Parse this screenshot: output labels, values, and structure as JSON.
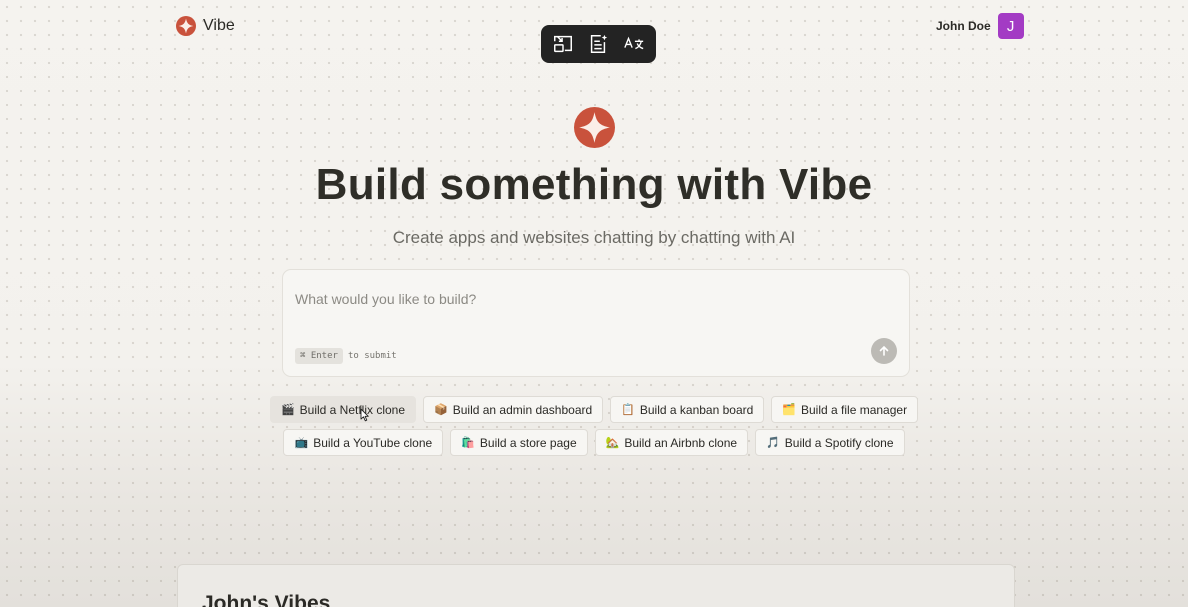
{
  "header": {
    "brand": "Vibe",
    "user_name": "John Doe",
    "avatar_initial": "J"
  },
  "toolbar": {
    "icons": [
      "exit-pip-icon",
      "ai-document-icon",
      "translate-icon"
    ]
  },
  "hero": {
    "title": "Build something with Vibe",
    "subtitle": "Create apps and websites chatting by chatting with AI"
  },
  "prompt": {
    "placeholder": "What would you like to build?",
    "value": "",
    "shortcut_key": "⌘ Enter",
    "shortcut_hint": "to submit"
  },
  "suggestions": {
    "row1": [
      {
        "icon": "🎬",
        "label": "Build a Netflix clone"
      },
      {
        "icon": "📦",
        "label": "Build an admin dashboard"
      },
      {
        "icon": "📋",
        "label": "Build a kanban board"
      },
      {
        "icon": "🗂️",
        "label": "Build a file manager"
      }
    ],
    "row2": [
      {
        "icon": "📺",
        "label": "Build a YouTube clone"
      },
      {
        "icon": "🛍️",
        "label": "Build a store page"
      },
      {
        "icon": "🏡",
        "label": "Build an Airbnb clone"
      },
      {
        "icon": "🎵",
        "label": "Build a Spotify clone"
      }
    ]
  },
  "vibes": {
    "title": "John's Vibes"
  },
  "colors": {
    "accent": "#c9523c",
    "avatar_bg": "#a33bc4",
    "toolbar_bg": "#232323"
  }
}
